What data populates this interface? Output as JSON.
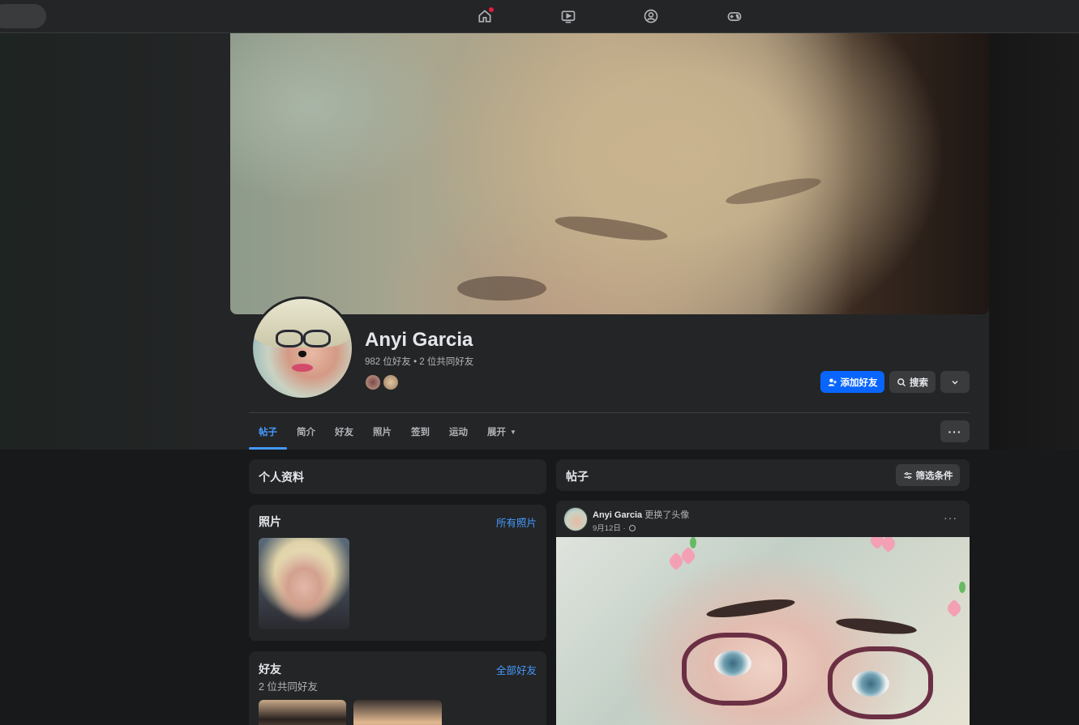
{
  "nav": {
    "icons": [
      "home-icon",
      "video-icon",
      "groups-icon",
      "gaming-icon"
    ]
  },
  "profile": {
    "name": "Anyi Garcia",
    "friend_summary": "982 位好友 • 2 位共同好友",
    "actions": {
      "add_friend": "添加好友",
      "search": "搜索"
    }
  },
  "tabs": [
    {
      "label": "帖子",
      "active": true
    },
    {
      "label": "简介"
    },
    {
      "label": "好友"
    },
    {
      "label": "照片"
    },
    {
      "label": "签到"
    },
    {
      "label": "运动"
    },
    {
      "label": "展开"
    }
  ],
  "sidebar": {
    "intro": {
      "title": "个人资料"
    },
    "photos": {
      "title": "照片",
      "link": "所有照片"
    },
    "friends": {
      "title": "好友",
      "link": "全部好友",
      "subtitle": "2 位共同好友"
    }
  },
  "posts": {
    "header": {
      "title": "帖子",
      "filter_label": "筛选条件"
    },
    "items": [
      {
        "author": "Anyi Garcia",
        "action": "更换了头像",
        "date": "9月12日 ·",
        "privacy_icon": "globe-icon"
      }
    ]
  },
  "colors": {
    "accent": "#4599ff",
    "primary_button": "#0866ff",
    "card_bg": "#242526",
    "page_bg": "#18191a"
  }
}
